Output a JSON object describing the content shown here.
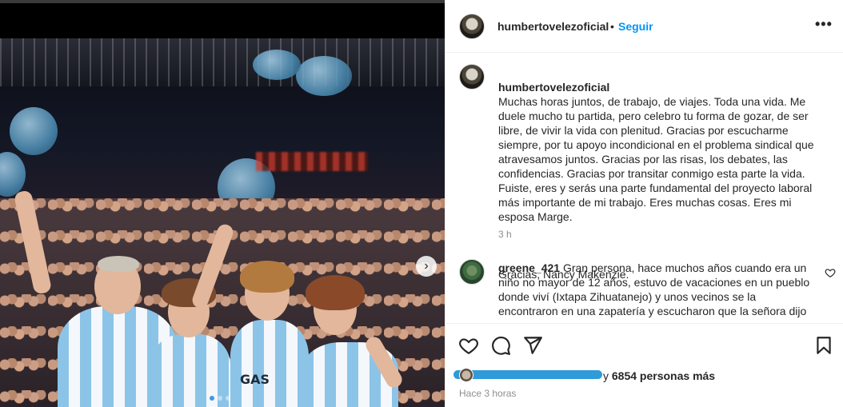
{
  "post": {
    "username": "humbertovelezoficial",
    "separator": "•",
    "follow_label": "Seguir",
    "more_icon": "more-horizontal-icon"
  },
  "caption": {
    "username": "humbertovelezoficial",
    "text": "Muchas horas juntos, de trabajo, de viajes. Toda una vida. Me duele mucho tu partida, pero celebro tu forma de gozar, de ser libre, de vivir la vida con plenitud. Gracias por escucharme siempre, por tu apoyo incondicional en el problema sindical que atravesamos juntos. Gracias por las risas, los debates, las confidencias. Gracias por transitar conmigo esta parte la vida. Fuiste, eres y serás una parte fundamental del proyecto laboral más importante de mi trabajo. Eres muchas cosas. Eres mi esposa Marge.",
    "signoff": "Gracias, Nancy Makenzie.",
    "time": "3 h"
  },
  "comment": {
    "username": "greene_421",
    "text": "Gran persona, hace muchos años cuando era un niño no mayor de 12 años, estuvo de vacaciones en un pueblo donde viví (Ixtapa Zihuatanejo) y unos vecinos se la encontraron en una zapatería y escucharon que la señora dijo"
  },
  "photo": {
    "shirt_text": "GAS",
    "next_icon": "chevron-right-icon",
    "slide_count": 3,
    "active_slide": 1
  },
  "actions": {
    "like_icon": "heart-icon",
    "comment_icon": "comment-icon",
    "share_icon": "send-icon",
    "save_icon": "bookmark-icon"
  },
  "likes": {
    "prefix": "y",
    "count_text": "6854 personas más"
  },
  "timestamp": "Hace 3 horas",
  "colors": {
    "accent": "#0095f6",
    "text": "#262626",
    "muted": "#8e8e8e",
    "divider": "#efefef",
    "shirt_blue": "#8cc4e8",
    "scribble": "#2f9bd8"
  }
}
